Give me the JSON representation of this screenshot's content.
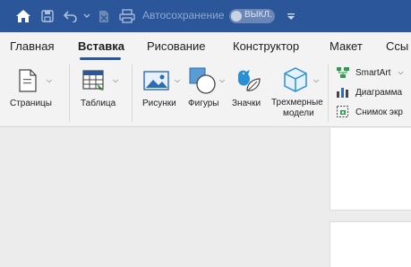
{
  "titlebar": {
    "background": "#2b579a",
    "autosave_label": "Автосохранение",
    "toggle_label": "ВЫКЛ.",
    "icons": [
      "home-icon",
      "save-icon",
      "undo-icon",
      "chevron-down-icon",
      "document-icon",
      "print-icon",
      "customize-toolbar-icon"
    ]
  },
  "tabs": [
    {
      "label": "Главная",
      "active": false
    },
    {
      "label": "Вставка",
      "active": true
    },
    {
      "label": "Рисование",
      "active": false
    },
    {
      "label": "Конструктор",
      "active": false
    },
    {
      "label": "Макет",
      "active": false
    },
    {
      "label": "Ссы",
      "active": false
    }
  ],
  "ribbon": {
    "pages": "Страницы",
    "table": "Таблица",
    "pictures": "Рисунки",
    "shapes": "Фигуры",
    "icons": "Значки",
    "models_line1": "Трехмерные",
    "models_line2": "модели",
    "smartart": "SmartArt",
    "chart": "Диаграмма",
    "screenshot": "Снимок экр"
  },
  "accent": "#2b579a"
}
